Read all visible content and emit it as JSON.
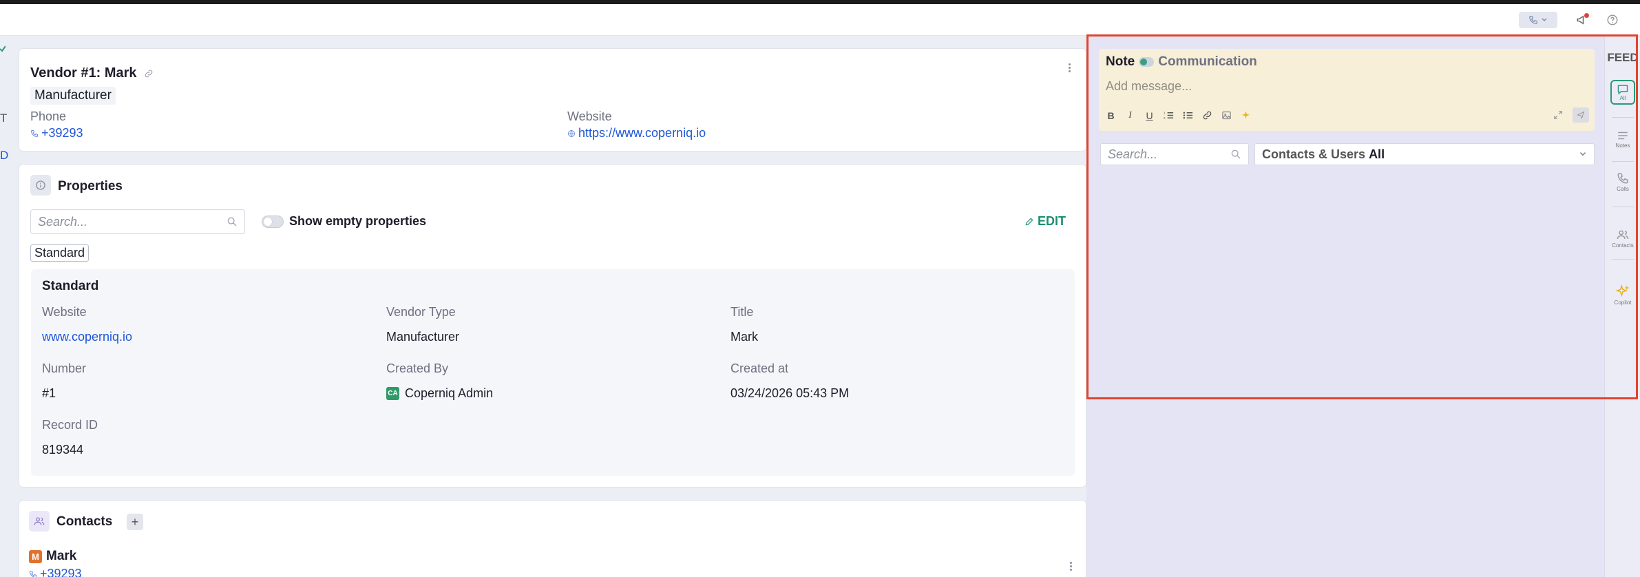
{
  "topbar": {
    "phone_icon": "phone-icon",
    "notifications_icon": "megaphone-icon",
    "help_icon": "help-circle-icon"
  },
  "vendor": {
    "title": "Vendor #1:  Mark",
    "type_chip": "Manufacturer",
    "phone_label": "Phone",
    "phone_value": "+39293",
    "website_label": "Website",
    "website_value": "https://www.coperniq.io"
  },
  "properties": {
    "title": "Properties",
    "search_placeholder": "Search...",
    "show_empty_label": "Show empty properties",
    "edit_label": "EDIT",
    "group_chip": "Standard",
    "panel_title": "Standard",
    "fields": [
      {
        "label": "Website",
        "value": "www.coperniq.io"
      },
      {
        "label": "Vendor Type",
        "value": "Manufacturer"
      },
      {
        "label": "Title",
        "value": "Mark"
      },
      {
        "label": "Number",
        "value": "#1"
      },
      {
        "label": "Created By",
        "value": "Coperniq Admin"
      },
      {
        "label": "Created at",
        "value": "03/24/2026 05:43 PM"
      },
      {
        "label": "Record ID",
        "value": "819344"
      }
    ],
    "created_by_avatar": "CA"
  },
  "contacts": {
    "title": "Contacts",
    "items": [
      {
        "initial": "M",
        "name": "Mark",
        "phone": "+39293"
      }
    ]
  },
  "feed": {
    "label": "FEED",
    "note_label": "Note",
    "communication_label": "Communication",
    "message_placeholder": "Add message...",
    "search_placeholder": "Search...",
    "filter_label": "Contacts & Users",
    "filter_value": "All",
    "side_items": [
      {
        "label": "All"
      },
      {
        "label": "Notes"
      },
      {
        "label": "Calls"
      },
      {
        "label": "Contacts"
      },
      {
        "label": "Copilot"
      }
    ]
  },
  "left_edge": {
    "mark_1": "T",
    "mark_2": "D"
  }
}
